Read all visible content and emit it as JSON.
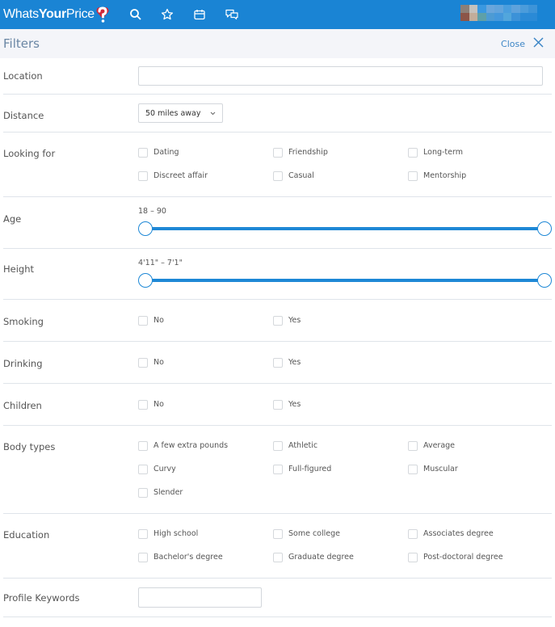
{
  "app": {
    "logo": {
      "part1": "Whats",
      "part2": "Your",
      "part3": "Price"
    },
    "nav_icons": [
      "search-icon",
      "star-icon",
      "calendar-icon",
      "chat-icon"
    ],
    "brand_color": "#1a84d4"
  },
  "filters": {
    "title": "Filters",
    "close_label": "Close"
  },
  "sections": {
    "location": {
      "label": "Location",
      "value": ""
    },
    "distance": {
      "label": "Distance",
      "selected": "50 miles away"
    },
    "looking_for": {
      "label": "Looking for",
      "options": [
        "Dating",
        "Friendship",
        "Long-term",
        "Discreet affair",
        "Casual",
        "Mentorship"
      ]
    },
    "age": {
      "label": "Age",
      "range_text": "18 – 90",
      "min": 18,
      "max": 90,
      "low": 18,
      "high": 90
    },
    "height": {
      "label": "Height",
      "range_text": "4'11\" – 7'1\"",
      "low": "4'11\"",
      "high": "7'1\""
    },
    "smoking": {
      "label": "Smoking",
      "options": [
        "No",
        "Yes"
      ]
    },
    "drinking": {
      "label": "Drinking",
      "options": [
        "No",
        "Yes"
      ]
    },
    "children": {
      "label": "Children",
      "options": [
        "No",
        "Yes"
      ]
    },
    "body_types": {
      "label": "Body types",
      "options": [
        "A few extra pounds",
        "Athletic",
        "Average",
        "Curvy",
        "Full-figured",
        "Muscular",
        "Slender"
      ]
    },
    "education": {
      "label": "Education",
      "options": [
        "High school",
        "Some college",
        "Associates degree",
        "Bachelor's degree",
        "Graduate degree",
        "Post-doctoral degree"
      ]
    },
    "keywords": {
      "label": "Profile Keywords",
      "value": ""
    }
  }
}
